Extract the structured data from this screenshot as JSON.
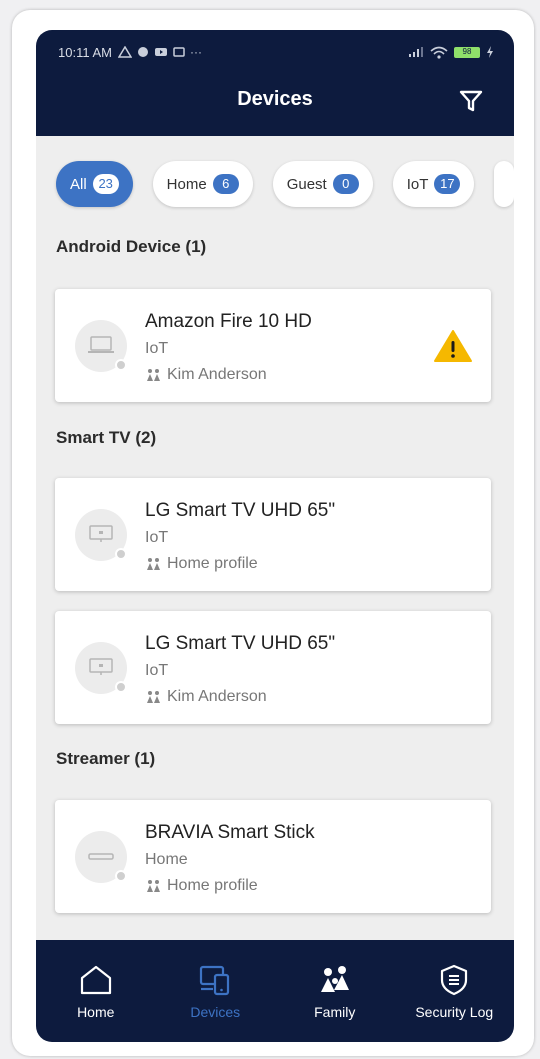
{
  "status_bar": {
    "time": "10:11 AM",
    "battery": "98"
  },
  "header": {
    "title": "Devices"
  },
  "chips": [
    {
      "label": "All",
      "count": "23",
      "active": true
    },
    {
      "label": "Home",
      "count": "6"
    },
    {
      "label": "Guest",
      "count": "0"
    },
    {
      "label": "IoT",
      "count": "17"
    }
  ],
  "sections": [
    {
      "title": "Android Device (1)",
      "devices": [
        {
          "name": "Amazon Fire 10 HD",
          "type": "IoT",
          "owner": "Kim Anderson",
          "icon": "laptop-icon",
          "warning": true
        }
      ]
    },
    {
      "title": "Smart TV (2)",
      "devices": [
        {
          "name": "LG Smart TV UHD 65\"",
          "type": "IoT",
          "owner": "Home profile",
          "icon": "tv-icon"
        },
        {
          "name": "LG Smart TV UHD 65\"",
          "type": "IoT",
          "owner": "Kim Anderson",
          "icon": "tv-icon"
        }
      ]
    },
    {
      "title": "Streamer (1)",
      "devices": [
        {
          "name": "BRAVIA Smart Stick",
          "type": "Home",
          "owner": "Home profile",
          "icon": "streamer-icon"
        }
      ]
    }
  ],
  "bottom_nav": [
    {
      "label": "Home",
      "icon": "home-icon"
    },
    {
      "label": "Devices",
      "icon": "devices-icon",
      "active": true
    },
    {
      "label": "Family",
      "icon": "family-icon"
    },
    {
      "label": "Security Log",
      "icon": "shield-icon"
    }
  ],
  "colors": {
    "header_bg": "#0d1b3e",
    "accent": "#3d73c4",
    "warning": "#f5b800",
    "background": "#eeeeee"
  }
}
